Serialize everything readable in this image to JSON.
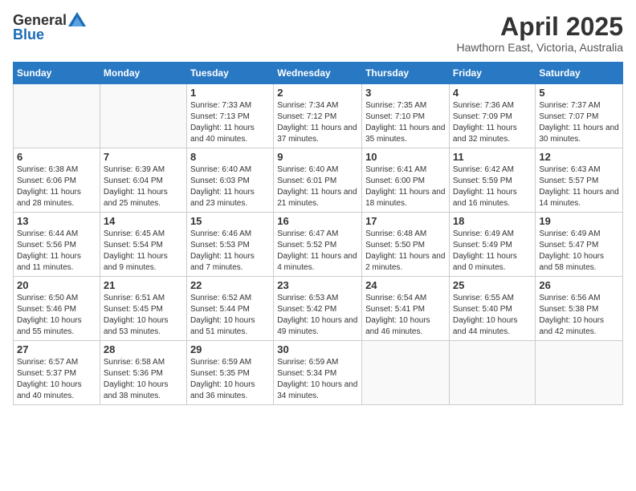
{
  "header": {
    "logo_general": "General",
    "logo_blue": "Blue",
    "month_title": "April 2025",
    "location": "Hawthorn East, Victoria, Australia"
  },
  "days_of_week": [
    "Sunday",
    "Monday",
    "Tuesday",
    "Wednesday",
    "Thursday",
    "Friday",
    "Saturday"
  ],
  "weeks": [
    [
      {
        "day": "",
        "info": ""
      },
      {
        "day": "",
        "info": ""
      },
      {
        "day": "1",
        "info": "Sunrise: 7:33 AM\nSunset: 7:13 PM\nDaylight: 11 hours and 40 minutes."
      },
      {
        "day": "2",
        "info": "Sunrise: 7:34 AM\nSunset: 7:12 PM\nDaylight: 11 hours and 37 minutes."
      },
      {
        "day": "3",
        "info": "Sunrise: 7:35 AM\nSunset: 7:10 PM\nDaylight: 11 hours and 35 minutes."
      },
      {
        "day": "4",
        "info": "Sunrise: 7:36 AM\nSunset: 7:09 PM\nDaylight: 11 hours and 32 minutes."
      },
      {
        "day": "5",
        "info": "Sunrise: 7:37 AM\nSunset: 7:07 PM\nDaylight: 11 hours and 30 minutes."
      }
    ],
    [
      {
        "day": "6",
        "info": "Sunrise: 6:38 AM\nSunset: 6:06 PM\nDaylight: 11 hours and 28 minutes."
      },
      {
        "day": "7",
        "info": "Sunrise: 6:39 AM\nSunset: 6:04 PM\nDaylight: 11 hours and 25 minutes."
      },
      {
        "day": "8",
        "info": "Sunrise: 6:40 AM\nSunset: 6:03 PM\nDaylight: 11 hours and 23 minutes."
      },
      {
        "day": "9",
        "info": "Sunrise: 6:40 AM\nSunset: 6:01 PM\nDaylight: 11 hours and 21 minutes."
      },
      {
        "day": "10",
        "info": "Sunrise: 6:41 AM\nSunset: 6:00 PM\nDaylight: 11 hours and 18 minutes."
      },
      {
        "day": "11",
        "info": "Sunrise: 6:42 AM\nSunset: 5:59 PM\nDaylight: 11 hours and 16 minutes."
      },
      {
        "day": "12",
        "info": "Sunrise: 6:43 AM\nSunset: 5:57 PM\nDaylight: 11 hours and 14 minutes."
      }
    ],
    [
      {
        "day": "13",
        "info": "Sunrise: 6:44 AM\nSunset: 5:56 PM\nDaylight: 11 hours and 11 minutes."
      },
      {
        "day": "14",
        "info": "Sunrise: 6:45 AM\nSunset: 5:54 PM\nDaylight: 11 hours and 9 minutes."
      },
      {
        "day": "15",
        "info": "Sunrise: 6:46 AM\nSunset: 5:53 PM\nDaylight: 11 hours and 7 minutes."
      },
      {
        "day": "16",
        "info": "Sunrise: 6:47 AM\nSunset: 5:52 PM\nDaylight: 11 hours and 4 minutes."
      },
      {
        "day": "17",
        "info": "Sunrise: 6:48 AM\nSunset: 5:50 PM\nDaylight: 11 hours and 2 minutes."
      },
      {
        "day": "18",
        "info": "Sunrise: 6:49 AM\nSunset: 5:49 PM\nDaylight: 11 hours and 0 minutes."
      },
      {
        "day": "19",
        "info": "Sunrise: 6:49 AM\nSunset: 5:47 PM\nDaylight: 10 hours and 58 minutes."
      }
    ],
    [
      {
        "day": "20",
        "info": "Sunrise: 6:50 AM\nSunset: 5:46 PM\nDaylight: 10 hours and 55 minutes."
      },
      {
        "day": "21",
        "info": "Sunrise: 6:51 AM\nSunset: 5:45 PM\nDaylight: 10 hours and 53 minutes."
      },
      {
        "day": "22",
        "info": "Sunrise: 6:52 AM\nSunset: 5:44 PM\nDaylight: 10 hours and 51 minutes."
      },
      {
        "day": "23",
        "info": "Sunrise: 6:53 AM\nSunset: 5:42 PM\nDaylight: 10 hours and 49 minutes."
      },
      {
        "day": "24",
        "info": "Sunrise: 6:54 AM\nSunset: 5:41 PM\nDaylight: 10 hours and 46 minutes."
      },
      {
        "day": "25",
        "info": "Sunrise: 6:55 AM\nSunset: 5:40 PM\nDaylight: 10 hours and 44 minutes."
      },
      {
        "day": "26",
        "info": "Sunrise: 6:56 AM\nSunset: 5:38 PM\nDaylight: 10 hours and 42 minutes."
      }
    ],
    [
      {
        "day": "27",
        "info": "Sunrise: 6:57 AM\nSunset: 5:37 PM\nDaylight: 10 hours and 40 minutes."
      },
      {
        "day": "28",
        "info": "Sunrise: 6:58 AM\nSunset: 5:36 PM\nDaylight: 10 hours and 38 minutes."
      },
      {
        "day": "29",
        "info": "Sunrise: 6:59 AM\nSunset: 5:35 PM\nDaylight: 10 hours and 36 minutes."
      },
      {
        "day": "30",
        "info": "Sunrise: 6:59 AM\nSunset: 5:34 PM\nDaylight: 10 hours and 34 minutes."
      },
      {
        "day": "",
        "info": ""
      },
      {
        "day": "",
        "info": ""
      },
      {
        "day": "",
        "info": ""
      }
    ]
  ]
}
